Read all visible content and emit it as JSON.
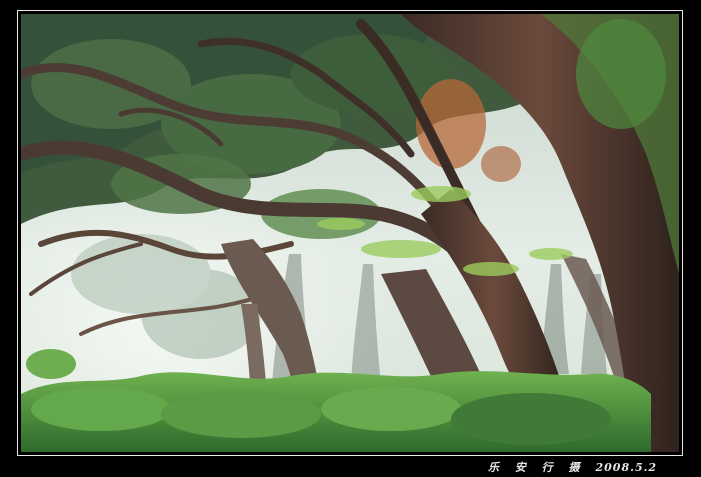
{
  "photo": {
    "subject": "",
    "palette": {
      "mist": "#dfe8e2",
      "canopy": "#3f5a3c",
      "foliage": "#4f8a3e",
      "fern": "#5fa34a",
      "bark": "#5a3e33",
      "bark_dark": "#3a2a24",
      "autumn_leaves": "#b5683a",
      "frame_border": "#e8e8e8"
    }
  },
  "caption": {
    "author": "乐 安 行 摄",
    "date": "2008.5.2"
  }
}
